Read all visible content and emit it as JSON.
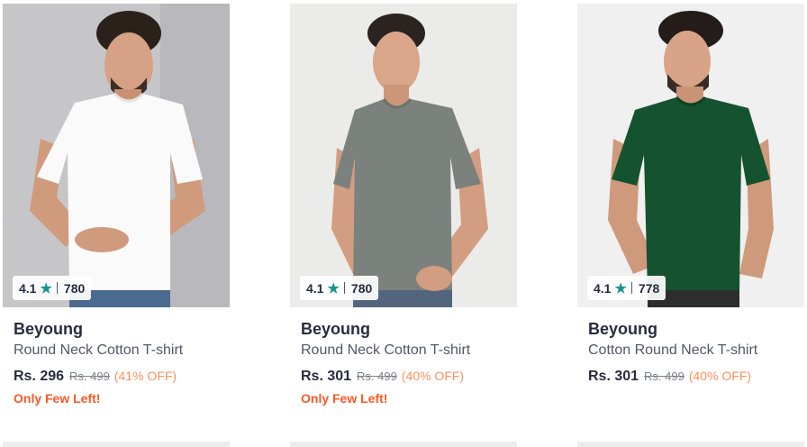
{
  "products": [
    {
      "brand": "Beyoung",
      "name": "Round Neck Cotton T-shirt",
      "rating": "4.1",
      "rating_count": "780",
      "price": "Rs. 296",
      "mrp": "Rs. 499",
      "discount": "(41% OFF)",
      "stock_note": "Only Few Left!",
      "shirt_color": "#fafafa",
      "bg_color": "#c9c9cc"
    },
    {
      "brand": "Beyoung",
      "name": "Round Neck Cotton T-shirt",
      "rating": "4.1",
      "rating_count": "780",
      "price": "Rs. 301",
      "mrp": "Rs. 499",
      "discount": "(40% OFF)",
      "stock_note": "Only Few Left!",
      "shirt_color": "#7b817c",
      "bg_color": "#ededeb"
    },
    {
      "brand": "Beyoung",
      "name": "Cotton Round Neck T-shirt",
      "rating": "4.1",
      "rating_count": "778",
      "price": "Rs. 301",
      "mrp": "Rs. 499",
      "discount": "(40% OFF)",
      "stock_note": "",
      "shirt_color": "#15522f",
      "bg_color": "#f1f1f1"
    }
  ],
  "icons": {
    "rating_star": "star-icon"
  },
  "colors": {
    "discount": "#ff905a",
    "stock": "#ff5722",
    "star": "#14958f"
  }
}
